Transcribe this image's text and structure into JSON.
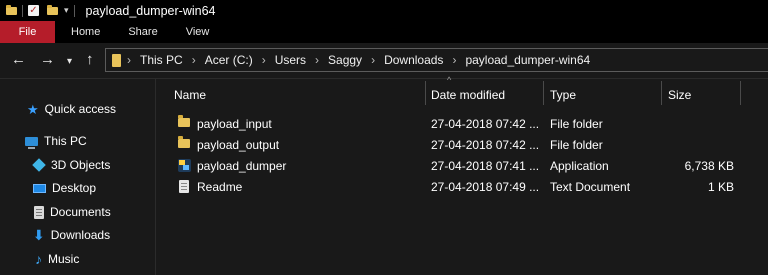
{
  "window": {
    "title": "payload_dumper-win64"
  },
  "ribbon": {
    "tabs": [
      "File",
      "Home",
      "Share",
      "View"
    ]
  },
  "address_bar": {
    "breadcrumb": [
      "This PC",
      "Acer (C:)",
      "Users",
      "Saggy",
      "Downloads",
      "payload_dumper-win64"
    ]
  },
  "nav_pane": {
    "items": [
      {
        "label": "Quick access",
        "icon": "quick-access-star-icon"
      },
      {
        "label": "This PC",
        "icon": "this-pc-icon"
      },
      {
        "label": "3D Objects",
        "icon": "3d-objects-icon"
      },
      {
        "label": "Desktop",
        "icon": "desktop-icon"
      },
      {
        "label": "Documents",
        "icon": "documents-icon"
      },
      {
        "label": "Downloads",
        "icon": "downloads-icon"
      },
      {
        "label": "Music",
        "icon": "music-icon"
      }
    ]
  },
  "file_list": {
    "columns": [
      "Name",
      "Date modified",
      "Type",
      "Size"
    ],
    "rows": [
      {
        "name": "payload_input",
        "date": "27-04-2018 07:42 ...",
        "type": "File folder",
        "size": "",
        "icon": "folder-icon"
      },
      {
        "name": "payload_output",
        "date": "27-04-2018 07:42 ...",
        "type": "File folder",
        "size": "",
        "icon": "folder-icon"
      },
      {
        "name": "payload_dumper",
        "date": "27-04-2018 07:41 ...",
        "type": "Application",
        "size": "6,738 KB",
        "icon": "application-icon"
      },
      {
        "name": "Readme",
        "date": "27-04-2018 07:49 ...",
        "type": "Text Document",
        "size": "1 KB",
        "icon": "text-document-icon"
      }
    ]
  },
  "colors": {
    "background": "#191919",
    "titlebar": "#000000",
    "file_tab": "#b51d2a",
    "folder": "#e8c35a",
    "accent_blue": "#2d8ed8"
  }
}
